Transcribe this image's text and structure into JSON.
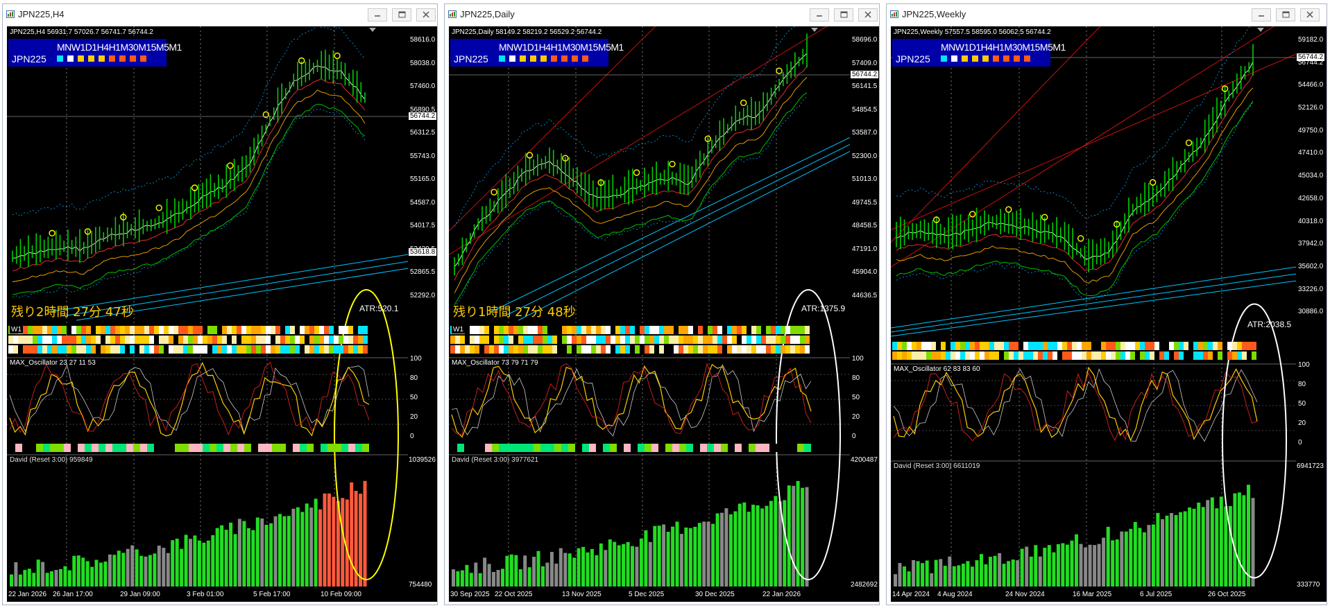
{
  "windows": [
    {
      "id": "h4",
      "title": "JPN225,H4",
      "ohlc": "JPN225,H4  56931.7 57026.7 56741.7 56744.2",
      "tf_row": "MNW1D1H4H1M30M15M5M1",
      "tf_symbol": "JPN225",
      "remaining": "残り2時間 27分 47秒",
      "atr": "ATR:520.1",
      "osc_label": "MAX_Oscillator 23 27 11 53",
      "david_label": "David (Reset 3:00) 959849",
      "stripe_label_w1": "W1",
      "price_ticks": [
        "58616.0",
        "58038.0",
        "57460.0",
        "56890.5",
        "56312.5",
        "55743.0",
        "55165.0",
        "54587.0",
        "54017.5",
        "53439.5",
        "52865.5",
        "52292.0"
      ],
      "price_box_current": "56744.2",
      "price_box_line": "53618.8",
      "osc_ticks": [
        "100",
        "80",
        "50",
        "20",
        "0"
      ],
      "david_ticks": [
        "1039526",
        "754480"
      ],
      "dates": [
        "22 Jan 2026",
        "26 Jan 17:00",
        "29 Jan 09:00",
        "3 Feb 01:00",
        "5 Feb 17:00",
        "10 Feb 09:00"
      ],
      "circle_color": "#ffff00"
    },
    {
      "id": "daily",
      "title": "JPN225,Daily",
      "ohlc": "JPN225,Daily  58149.2 58219.2 56529.2 56744.2",
      "tf_row": "MNW1D1H4H1M30M15M5M1",
      "tf_symbol": "JPN225",
      "remaining": "残り1時間 27分 48秒",
      "atr": "ATR:1375.9",
      "osc_label": "MAX_Oscillator 73 79 71 79",
      "david_label": "David (Reset 3:00) 3977621",
      "stripe_label_w1": "W1",
      "price_ticks": [
        "58696.0",
        "57409.0",
        "56141.5",
        "54854.5",
        "53587.0",
        "52300.0",
        "51013.0",
        "49745.5",
        "48458.5",
        "47191.0",
        "45904.0",
        "44636.5"
      ],
      "price_box_current": "56744.2",
      "price_box_line": "",
      "osc_ticks": [
        "100",
        "80",
        "50",
        "20",
        "0"
      ],
      "david_ticks": [
        "4200487",
        "2482692"
      ],
      "dates": [
        "30 Sep 2025",
        "22 Oct 2025",
        "13 Nov 2025",
        "5 Dec 2025",
        "30 Dec 2025",
        "22 Jan 2026"
      ],
      "circle_color": "#ffffff"
    },
    {
      "id": "weekly",
      "title": "JPN225,Weekly",
      "ohlc": "JPN225,Weekly  57557.5 58595.0 56062.5 56744.2",
      "tf_row": "MNW1D1H4H1M30M15M5M1",
      "tf_symbol": "JPN225",
      "remaining": "",
      "atr": "ATR:2038.5",
      "osc_label": "MAX_Oscillator 62 83 83 60",
      "david_label": "David (Reset 3:00) 6611019",
      "stripe_label_w1": "",
      "price_ticks": [
        "59182.0",
        "56744.2",
        "54466.0",
        "52126.0",
        "49750.0",
        "47410.0",
        "45034.0",
        "42658.0",
        "40318.0",
        "37942.0",
        "35602.0",
        "33226.0",
        "30886.0"
      ],
      "price_box_current": "56744.2",
      "price_box_line": "",
      "osc_ticks": [
        "100",
        "80",
        "50",
        "20",
        "0"
      ],
      "david_ticks": [
        "6941723",
        "333770"
      ],
      "dates": [
        "14 Apr 2024",
        "4 Aug 2024",
        "24 Nov 2024",
        "16 Mar 2025",
        "6 Jul 2025",
        "26 Oct 2025"
      ],
      "circle_color": "#ffffff"
    }
  ],
  "colors": {
    "bull_candle": "#00d000",
    "ma_white": "#ffffff",
    "ma_red": "#ff4040",
    "ma_orange": "#ffaa00",
    "band_cyan": "#00ccff",
    "david_bull": "#22dd22",
    "david_bear": "#ff6040",
    "osc_yellow": "#ffcc00",
    "osc_cyan": "#33ddff"
  },
  "icons": [
    "minimize-icon",
    "maximize-icon",
    "close-icon",
    "chart-window-icon",
    "dropdown-triangle-icon"
  ]
}
